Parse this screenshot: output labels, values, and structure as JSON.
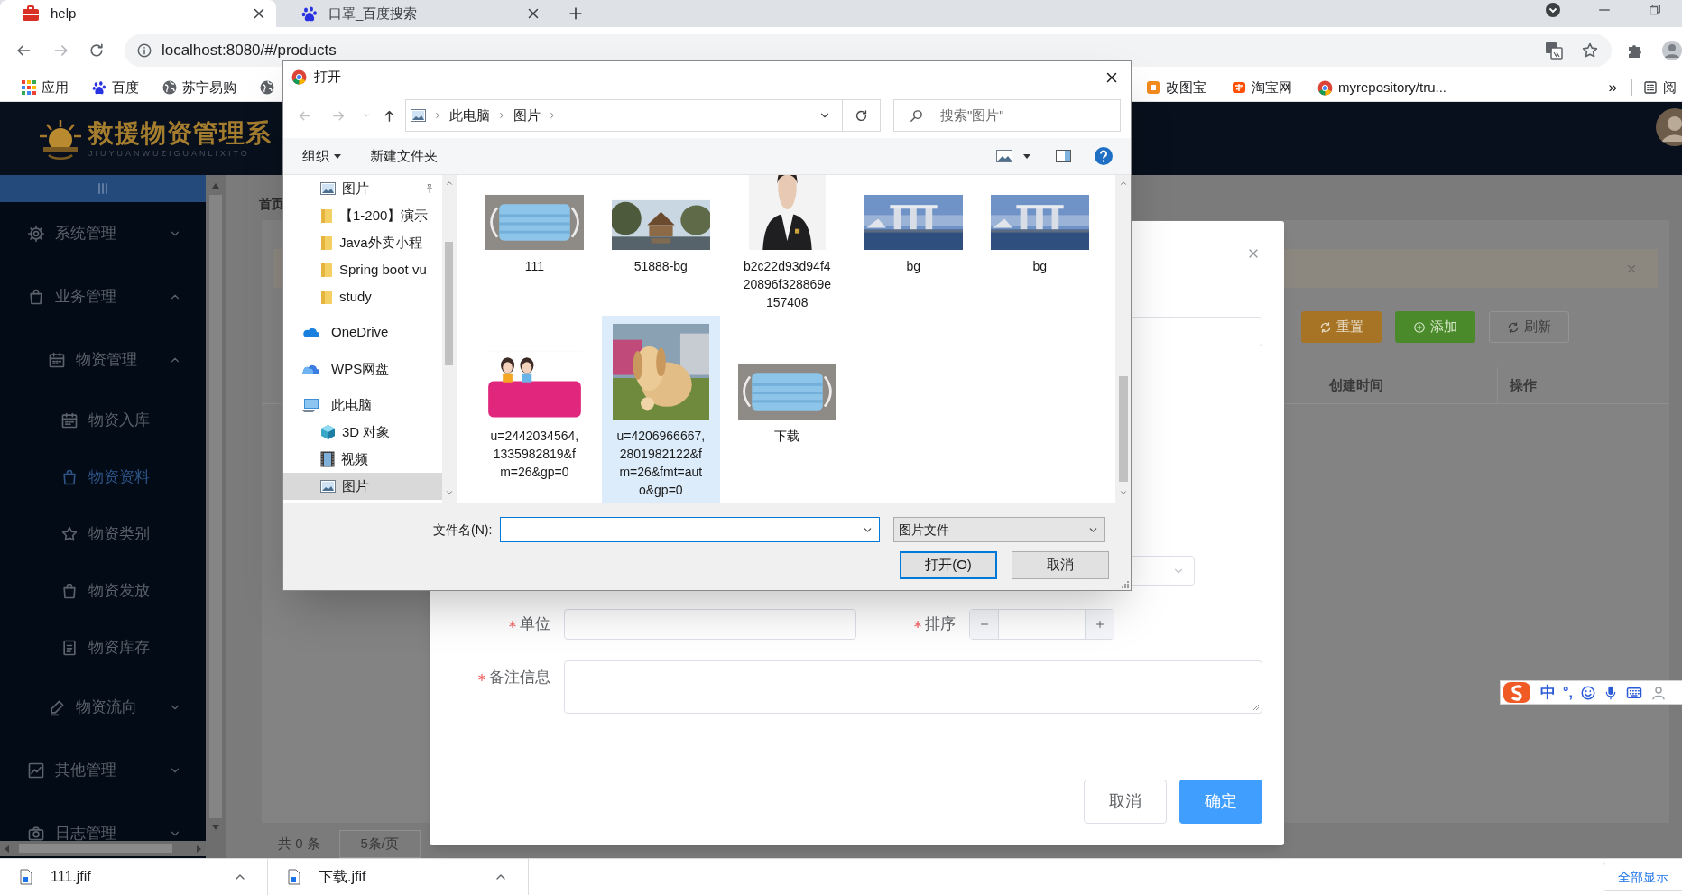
{
  "browser": {
    "tabs": [
      {
        "title": "help",
        "selected": true
      },
      {
        "title": "口罩_百度搜索",
        "selected": false
      }
    ],
    "address": "localhost:8080/#/products",
    "bookmarks": [
      {
        "label": "应用"
      },
      {
        "label": "百度"
      },
      {
        "label": "苏宁易购"
      }
    ],
    "bookmarks_right": [
      {
        "label": "改图宝"
      },
      {
        "label": "淘宝网"
      },
      {
        "label": "myrepository/tru..."
      }
    ],
    "overflow": "»",
    "reading_list": "阅"
  },
  "app": {
    "logo_title": "救援物资管理系",
    "logo_subtitle": "JIUYUANWUZIGUANLIXITO",
    "menu": [
      {
        "label": "系统管理",
        "expanded": false
      },
      {
        "label": "业务管理",
        "expanded": true,
        "children": [
          {
            "label": "物资管理",
            "expanded": true,
            "children": [
              {
                "label": "物资入库",
                "selected": false
              },
              {
                "label": "物资资料",
                "selected": true
              },
              {
                "label": "物资类别",
                "selected": false
              },
              {
                "label": "物资发放",
                "selected": false
              },
              {
                "label": "物资库存",
                "selected": false
              }
            ]
          },
          {
            "label": "物资流向",
            "expanded": false
          }
        ]
      },
      {
        "label": "其他管理",
        "expanded": false
      },
      {
        "label": "日志管理",
        "expanded": false
      }
    ],
    "breadcrumb": "首页",
    "toolbar": [
      {
        "label": "重置",
        "kind": "warning"
      },
      {
        "label": "添加",
        "kind": "success"
      },
      {
        "label": "刷新",
        "kind": "plain"
      }
    ],
    "table_columns": [
      "创建时间",
      "操作"
    ],
    "pagination": {
      "total": "共 0 条",
      "page_size": "5条/页"
    }
  },
  "form_dialog": {
    "fields": [
      {
        "label": "单位",
        "required": true,
        "kind": "text"
      },
      {
        "label": "排序",
        "required": true,
        "kind": "number"
      },
      {
        "label": "备注信息",
        "required": true,
        "kind": "textarea"
      }
    ],
    "buttons": [
      {
        "label": "取消",
        "primary": false
      },
      {
        "label": "确定",
        "primary": true
      }
    ]
  },
  "file_dialog": {
    "title": "打开",
    "path": [
      "此电脑",
      "图片"
    ],
    "search_placeholder": "搜索\"图片\"",
    "toolbar": [
      "组织",
      "新建文件夹"
    ],
    "quick_access": [
      {
        "label": "图片",
        "kind": "pictures",
        "pinned": true,
        "selected": false
      },
      {
        "label": "【1-200】演示",
        "kind": "folder",
        "pinned": false,
        "selected": false
      },
      {
        "label": "Java外卖小程",
        "kind": "folder",
        "pinned": false,
        "selected": false
      },
      {
        "label": "Spring boot vu",
        "kind": "folder",
        "pinned": false,
        "selected": false
      },
      {
        "label": "study",
        "kind": "folder",
        "pinned": false,
        "selected": false
      }
    ],
    "locations": [
      {
        "label": "OneDrive",
        "kind": "cloud",
        "selected": false
      },
      {
        "label": "WPS网盘",
        "kind": "cloud2",
        "selected": false
      },
      {
        "label": "此电脑",
        "kind": "computer",
        "selected": false,
        "children": [
          {
            "label": "3D 对象",
            "kind": "cube",
            "selected": false
          },
          {
            "label": "视频",
            "kind": "video",
            "selected": false
          },
          {
            "label": "图片",
            "kind": "pictures",
            "selected": true
          }
        ]
      }
    ],
    "files": [
      {
        "name": "111",
        "selected": false
      },
      {
        "name": "51888-bg",
        "selected": false
      },
      {
        "name": "b2c22d93d94f420896f328869e157408",
        "selected": false
      },
      {
        "name": "bg",
        "selected": false
      },
      {
        "name": "bg",
        "selected": false
      },
      {
        "name": "u=2442034564,1335982819&fm=26&gp=0",
        "selected": false
      },
      {
        "name": "u=4206966667,2801982122&fm=26&fmt=auto&gp=0",
        "selected": true
      },
      {
        "name": "下载",
        "selected": false
      }
    ],
    "filename_label": "文件名(N):",
    "filetype": "图片文件",
    "buttons": [
      {
        "label": "打开(O)",
        "default": true
      },
      {
        "label": "取消",
        "default": false
      }
    ]
  },
  "downloads": {
    "items": [
      "111.jfif",
      "下载.jfif"
    ],
    "show_all": "全部显示"
  },
  "ime": {
    "mode": "中",
    "punct": "°,"
  }
}
